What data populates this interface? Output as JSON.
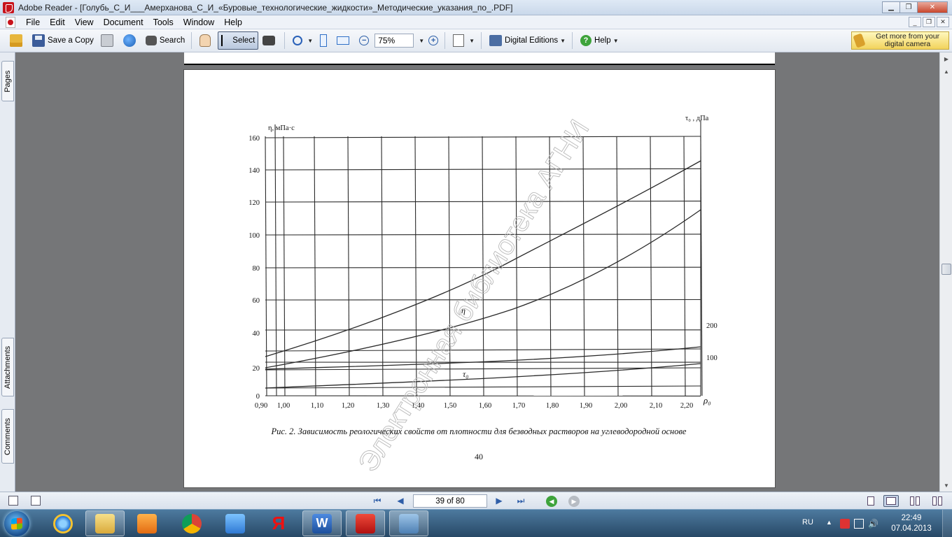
{
  "window": {
    "title": "Adobe Reader - [Голубь_С_И___Амерханова_С_И_«Буровые_технологические_жидкости»_Методические_указания_по_.PDF]"
  },
  "menu": [
    "File",
    "Edit",
    "View",
    "Document",
    "Tools",
    "Window",
    "Help"
  ],
  "toolbar": {
    "save_copy": "Save a Copy",
    "search": "Search",
    "select": "Select",
    "zoom": "75%",
    "digital_editions": "Digital Editions",
    "help": "Help",
    "promo": "Get more from your digital camera"
  },
  "side_tabs": [
    "Pages",
    "Attachments",
    "Comments"
  ],
  "status": {
    "page_indicator": "39 of 80"
  },
  "taskbar": {
    "lang": "RU",
    "time": "22:49",
    "date": "07.04.2013"
  },
  "document": {
    "watermark": "Электронная библиотека АГНИ",
    "caption": "Рис. 2. Зависимость реологических свойств от плотности для безводных растворов на углеводородной основе",
    "page_number": "40",
    "figure": {
      "left_axis_label": "η, мПа·с",
      "right_axis_label": "τ₀ , дПа",
      "x_axis_label": "ρ₀",
      "curve_label_eta": "η",
      "curve_label_tau": "τ₀",
      "left_ticks": [
        "0",
        "20",
        "40",
        "60",
        "80",
        "100",
        "120",
        "140",
        "160"
      ],
      "right_ticks": [
        "100",
        "200"
      ],
      "x_ticks": [
        "0,90",
        "1,00",
        "1,10",
        "1,20",
        "1,30",
        "1,40",
        "1,50",
        "1,60",
        "1,70",
        "1,80",
        "1,90",
        "2,00",
        "2,10",
        "2,20"
      ]
    }
  }
}
